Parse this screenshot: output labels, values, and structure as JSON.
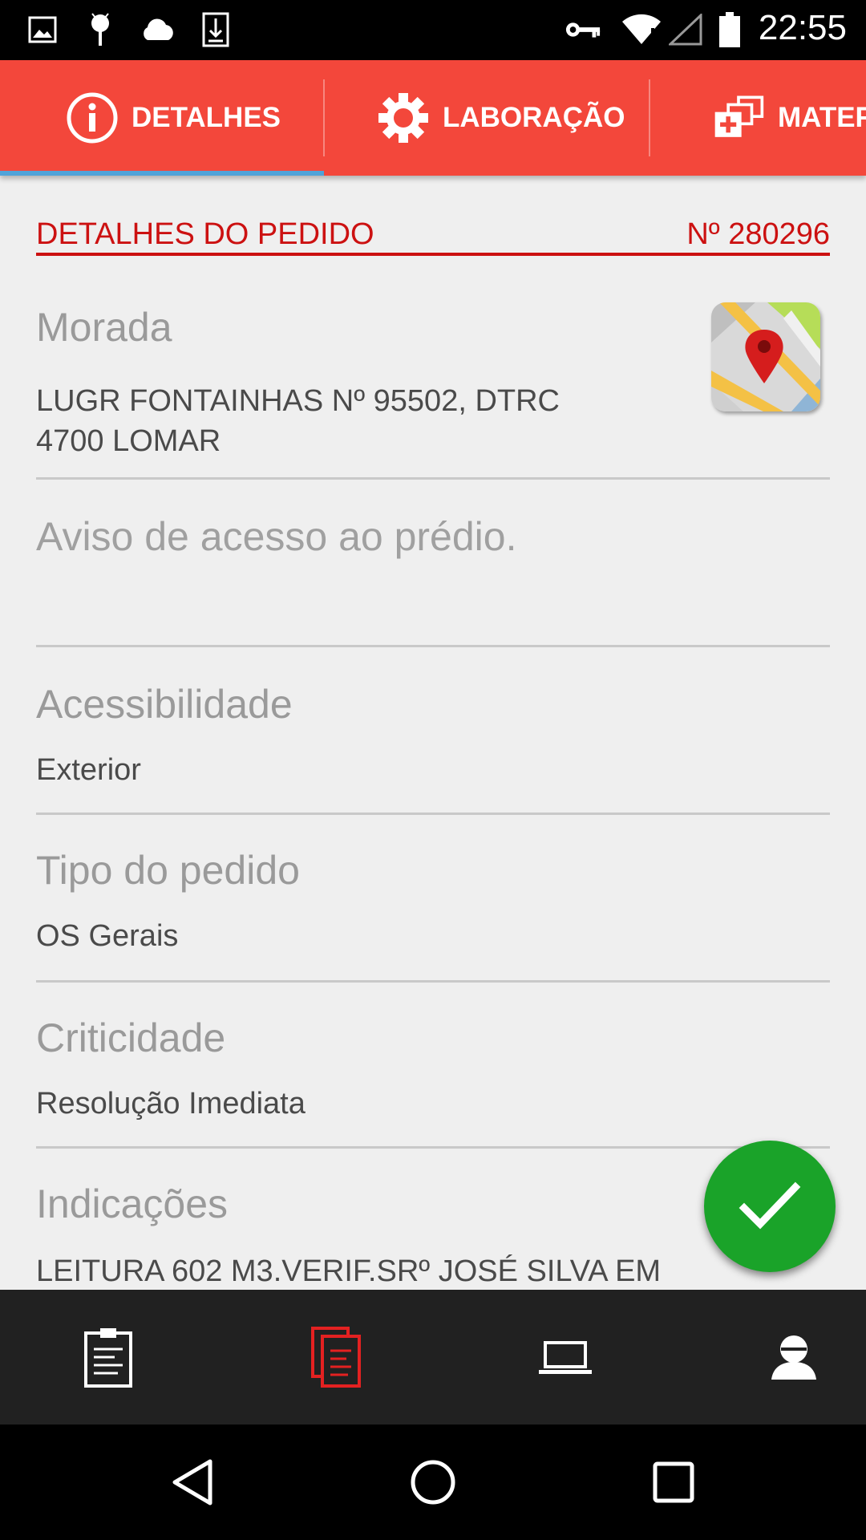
{
  "status_bar": {
    "time": "22:55",
    "icons": [
      "image-icon",
      "android-icon",
      "cloud-icon",
      "download-icon",
      "vpn-key-icon",
      "wifi-icon",
      "signal-icon",
      "battery-icon"
    ]
  },
  "tabs": [
    {
      "label": "DETALHES",
      "icon": "info-icon",
      "selected": true
    },
    {
      "label": "LABORAÇÃO",
      "icon": "gear-icon",
      "selected": false
    },
    {
      "label": "MATERIAIS",
      "icon": "add-materials-icon",
      "selected": false
    }
  ],
  "details": {
    "section_title": "DETALHES DO PEDIDO",
    "order_number": "Nº 280296",
    "morada": {
      "label": "Morada",
      "line1": "LUGR FONTAINHAS Nº 95502, DTRC",
      "line2": "4700 LOMAR"
    },
    "aviso": {
      "placeholder": "Aviso de acesso ao prédio."
    },
    "acessibilidade": {
      "label": "Acessibilidade",
      "value": "Exterior"
    },
    "tipo_pedido": {
      "label": "Tipo do pedido",
      "value": "OS Gerais"
    },
    "criticidade": {
      "label": "Criticidade",
      "value": "Resolução Imediata"
    },
    "indicacoes": {
      "label": "Indicações",
      "value": "LEITURA 602 M3.VERIF.SRº JOSÉ SILVA EM"
    }
  },
  "colors": {
    "accent": "#f3473b",
    "header_red": "#cc1111",
    "fab_green": "#1aa329",
    "tab_indicator": "#4fa3d9"
  },
  "bottom_nav": [
    {
      "icon": "clipboard-icon",
      "active": false
    },
    {
      "icon": "documents-icon",
      "active": true
    },
    {
      "icon": "laptop-icon",
      "active": false
    },
    {
      "icon": "user-icon",
      "active": false
    }
  ],
  "system_nav": [
    "back-icon",
    "home-icon",
    "recents-icon"
  ]
}
